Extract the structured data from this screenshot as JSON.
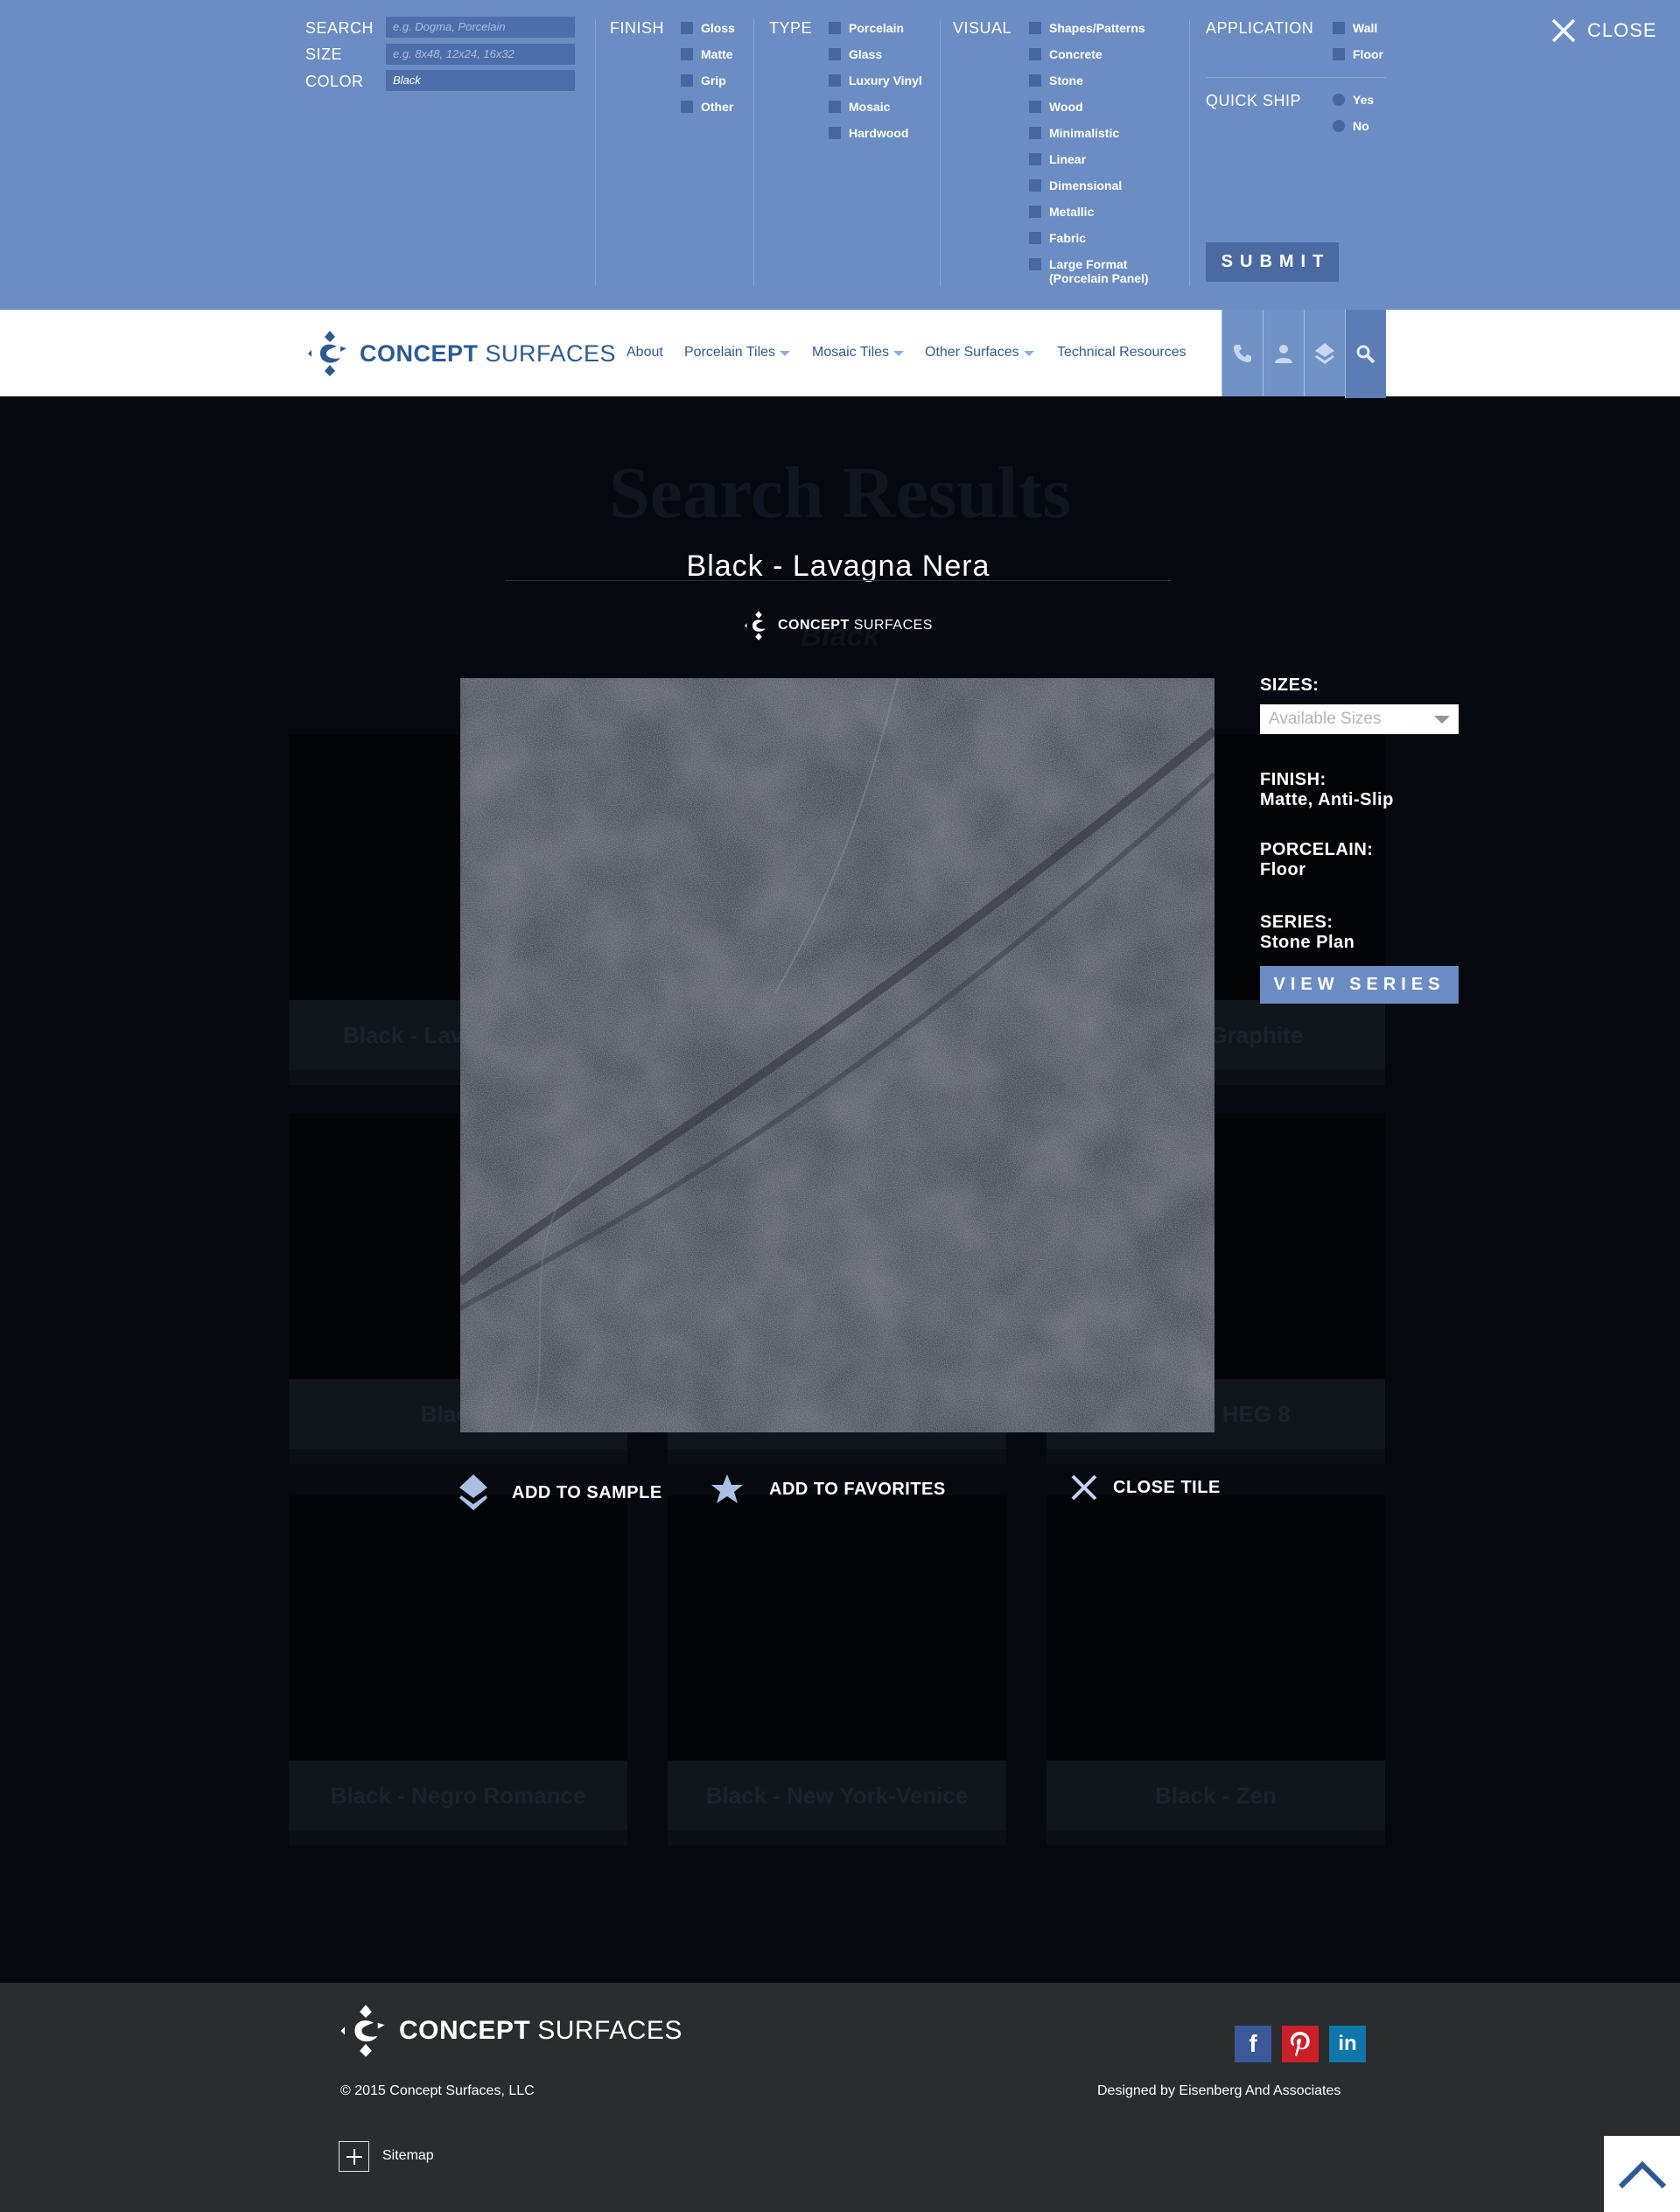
{
  "search_panel": {
    "search": {
      "label": "SEARCH",
      "placeholder": "e.g. Dogma, Porcelain",
      "value": ""
    },
    "size": {
      "label": "SIZE",
      "placeholder": "e.g. 8x48, 12x24, 16x32",
      "value": ""
    },
    "color": {
      "label": "COLOR",
      "placeholder": "",
      "value": "Black"
    },
    "finish": {
      "title": "FINISH",
      "options": [
        "Gloss",
        "Matte",
        "Grip",
        "Other"
      ]
    },
    "type": {
      "title": "TYPE",
      "options": [
        "Porcelain",
        "Glass",
        "Luxury Vinyl",
        "Mosaic",
        "Hardwood"
      ]
    },
    "visual": {
      "title": "VISUAL",
      "options": [
        "Shapes/Patterns",
        "Concrete",
        "Stone",
        "Wood",
        "Minimalistic",
        "Linear",
        "Dimensional",
        "Metallic",
        "Fabric",
        "Large Format",
        "(Porcelain Panel)"
      ]
    },
    "application": {
      "title": "APPLICATION",
      "options": [
        "Wall",
        "Floor"
      ]
    },
    "quick_ship": {
      "title": "QUICK SHIP",
      "options": [
        "Yes",
        "No"
      ]
    },
    "submit_label": "SUBMIT",
    "close_label": "CLOSE"
  },
  "header": {
    "logo": {
      "word1": "CONCEPT",
      "word2": "SURFACES"
    },
    "nav": [
      "About",
      "Porcelain Tiles",
      "Mosaic Tiles",
      "Other Surfaces",
      "Technical Resources"
    ],
    "icons": [
      "phone-icon",
      "user-icon",
      "sample-layers-icon",
      "search-icon"
    ]
  },
  "background_page": {
    "title": "Search Results",
    "subtitle": "Black",
    "cards": [
      "Black - Lavagna Nera",
      "",
      "Black - Graphite",
      "Black - ",
      "",
      "Black - HEG 8",
      "Black - Negro Romance",
      "Black - New York-Venice",
      "Black - Zen"
    ]
  },
  "modal": {
    "title": "Black - Lavagna Nera",
    "logo": {
      "word1": "CONCEPT",
      "word2": "SURFACES"
    },
    "sizes_label": "SIZES:",
    "sizes_placeholder": "Available Sizes",
    "finish_label": "FINISH:",
    "finish_value": "Matte, Anti-Slip",
    "porcelain_label": "PORCELAIN:",
    "porcelain_value": "Floor",
    "series_label": "SERIES:",
    "series_value": "Stone Plan",
    "view_series_label": "VIEW SERIES",
    "actions": {
      "add_sample": "ADD TO SAMPLE",
      "add_favorites": "ADD TO FAVORITES",
      "close_tile": "CLOSE TILE"
    }
  },
  "footer": {
    "logo": {
      "word1": "CONCEPT",
      "word2": "SURFACES"
    },
    "copyright": "© 2015 Concept Surfaces, LLC",
    "designed_by": "Designed by Eisenberg And Associates",
    "sitemap_label": "Sitemap",
    "social": [
      "facebook-icon",
      "pinterest-icon",
      "linkedin-icon"
    ]
  },
  "colors": {
    "panel": "#6c8dc3",
    "brand_blue": "#2d5a92",
    "footer": "#2b2c2e"
  }
}
